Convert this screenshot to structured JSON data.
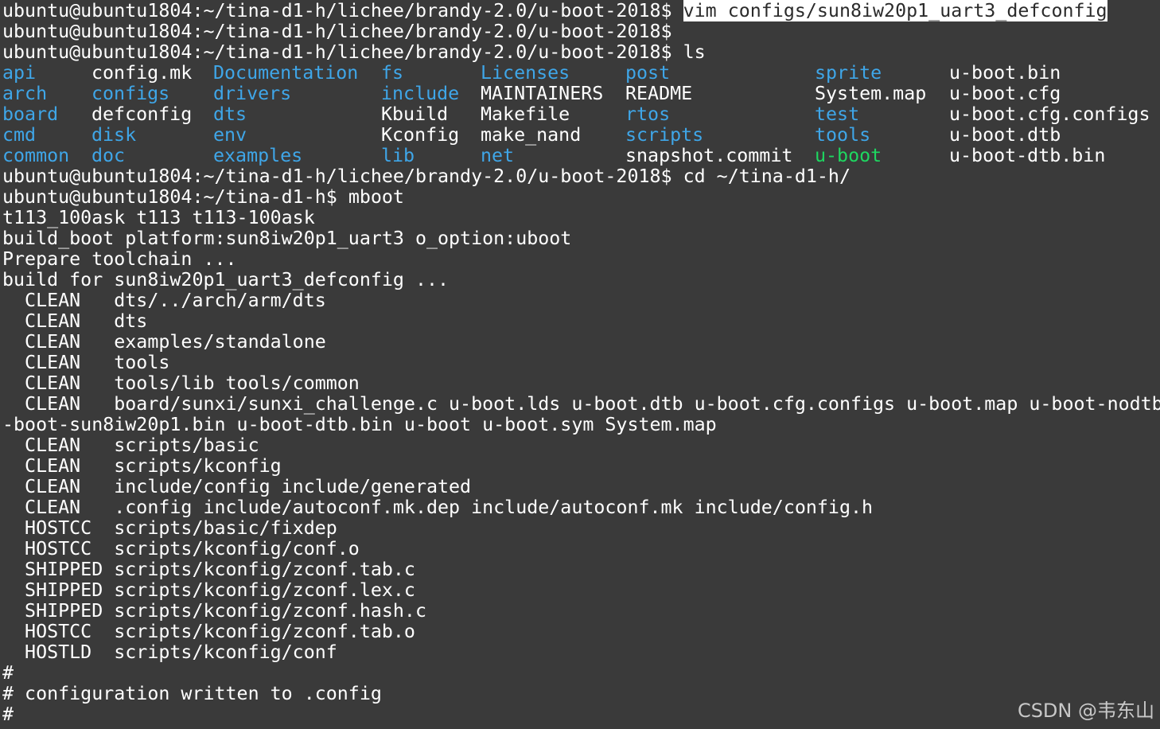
{
  "terminal": {
    "prompt_dir": "ubuntu@ubuntu1804:~/tina-d1-h/lichee/brandy-2.0/u-boot-2018$",
    "prompt_home": "ubuntu@ubuntu1804:~/tina-d1-h$",
    "cmd_vim": "vim configs/sun8iw20p1_uart3_defconfig",
    "cmd_ls": "ls",
    "cmd_cd": "cd ~/tina-d1-h/",
    "cmd_mboot": "mboot",
    "ls_output": [
      [
        {
          "name": "api",
          "kind": "dir"
        },
        {
          "name": "arch",
          "kind": "dir"
        },
        {
          "name": "board",
          "kind": "dir"
        },
        {
          "name": "cmd",
          "kind": "dir"
        },
        {
          "name": "common",
          "kind": "dir"
        }
      ],
      [
        {
          "name": "config.mk",
          "kind": "file"
        },
        {
          "name": "configs",
          "kind": "dir"
        },
        {
          "name": "defconfig",
          "kind": "file"
        },
        {
          "name": "disk",
          "kind": "dir"
        },
        {
          "name": "doc",
          "kind": "dir"
        }
      ],
      [
        {
          "name": "Documentation",
          "kind": "dir"
        },
        {
          "name": "drivers",
          "kind": "dir"
        },
        {
          "name": "dts",
          "kind": "dir"
        },
        {
          "name": "env",
          "kind": "dir"
        },
        {
          "name": "examples",
          "kind": "dir"
        }
      ],
      [
        {
          "name": "fs",
          "kind": "dir"
        },
        {
          "name": "include",
          "kind": "dir"
        },
        {
          "name": "Kbuild",
          "kind": "file"
        },
        {
          "name": "Kconfig",
          "kind": "file"
        },
        {
          "name": "lib",
          "kind": "dir"
        }
      ],
      [
        {
          "name": "Licenses",
          "kind": "dir"
        },
        {
          "name": "MAINTAINERS",
          "kind": "file"
        },
        {
          "name": "Makefile",
          "kind": "file"
        },
        {
          "name": "make_nand",
          "kind": "file"
        },
        {
          "name": "net",
          "kind": "dir"
        }
      ],
      [
        {
          "name": "post",
          "kind": "dir"
        },
        {
          "name": "README",
          "kind": "file"
        },
        {
          "name": "rtos",
          "kind": "dir"
        },
        {
          "name": "scripts",
          "kind": "dir"
        },
        {
          "name": "snapshot.commit",
          "kind": "file"
        }
      ],
      [
        {
          "name": "sprite",
          "kind": "dir"
        },
        {
          "name": "System.map",
          "kind": "file"
        },
        {
          "name": "test",
          "kind": "dir"
        },
        {
          "name": "tools",
          "kind": "dir"
        },
        {
          "name": "u-boot",
          "kind": "exec"
        }
      ],
      [
        {
          "name": "u-boot.bin",
          "kind": "file"
        },
        {
          "name": "u-boot.cfg",
          "kind": "file"
        },
        {
          "name": "u-boot.cfg.configs",
          "kind": "file"
        },
        {
          "name": "u-boot.dtb",
          "kind": "file"
        },
        {
          "name": "u-boot-dtb.bin",
          "kind": "file"
        }
      ]
    ],
    "build_output": [
      "t113_100ask t113 t113-100ask",
      "build_boot platform:sun8iw20p1_uart3 o_option:uboot",
      "Prepare toolchain ...",
      "build for sun8iw20p1_uart3_defconfig ...",
      "  CLEAN   dts/../arch/arm/dts",
      "  CLEAN   dts",
      "  CLEAN   examples/standalone",
      "  CLEAN   tools",
      "  CLEAN   tools/lib tools/common",
      "  CLEAN   board/sunxi/sunxi_challenge.c u-boot.lds u-boot.dtb u-boot.cfg.configs u-boot.map u-boot-nodtb",
      "-boot-sun8iw20p1.bin u-boot-dtb.bin u-boot u-boot.sym System.map",
      "  CLEAN   scripts/basic",
      "  CLEAN   scripts/kconfig",
      "  CLEAN   include/config include/generated",
      "  CLEAN   .config include/autoconf.mk.dep include/autoconf.mk include/config.h",
      "  HOSTCC  scripts/basic/fixdep",
      "  HOSTCC  scripts/kconfig/conf.o",
      "  SHIPPED scripts/kconfig/zconf.tab.c",
      "  SHIPPED scripts/kconfig/zconf.lex.c",
      "  SHIPPED scripts/kconfig/zconf.hash.c",
      "  HOSTCC  scripts/kconfig/zconf.tab.o",
      "  HOSTLD  scripts/kconfig/conf",
      "#",
      "# configuration written to .config",
      "#"
    ]
  },
  "watermark": "CSDN @韦东山",
  "colors": {
    "background": "#3a3a3a",
    "directory": "#3fa6e8",
    "executable": "#1ed760",
    "text": "#ffffff"
  }
}
